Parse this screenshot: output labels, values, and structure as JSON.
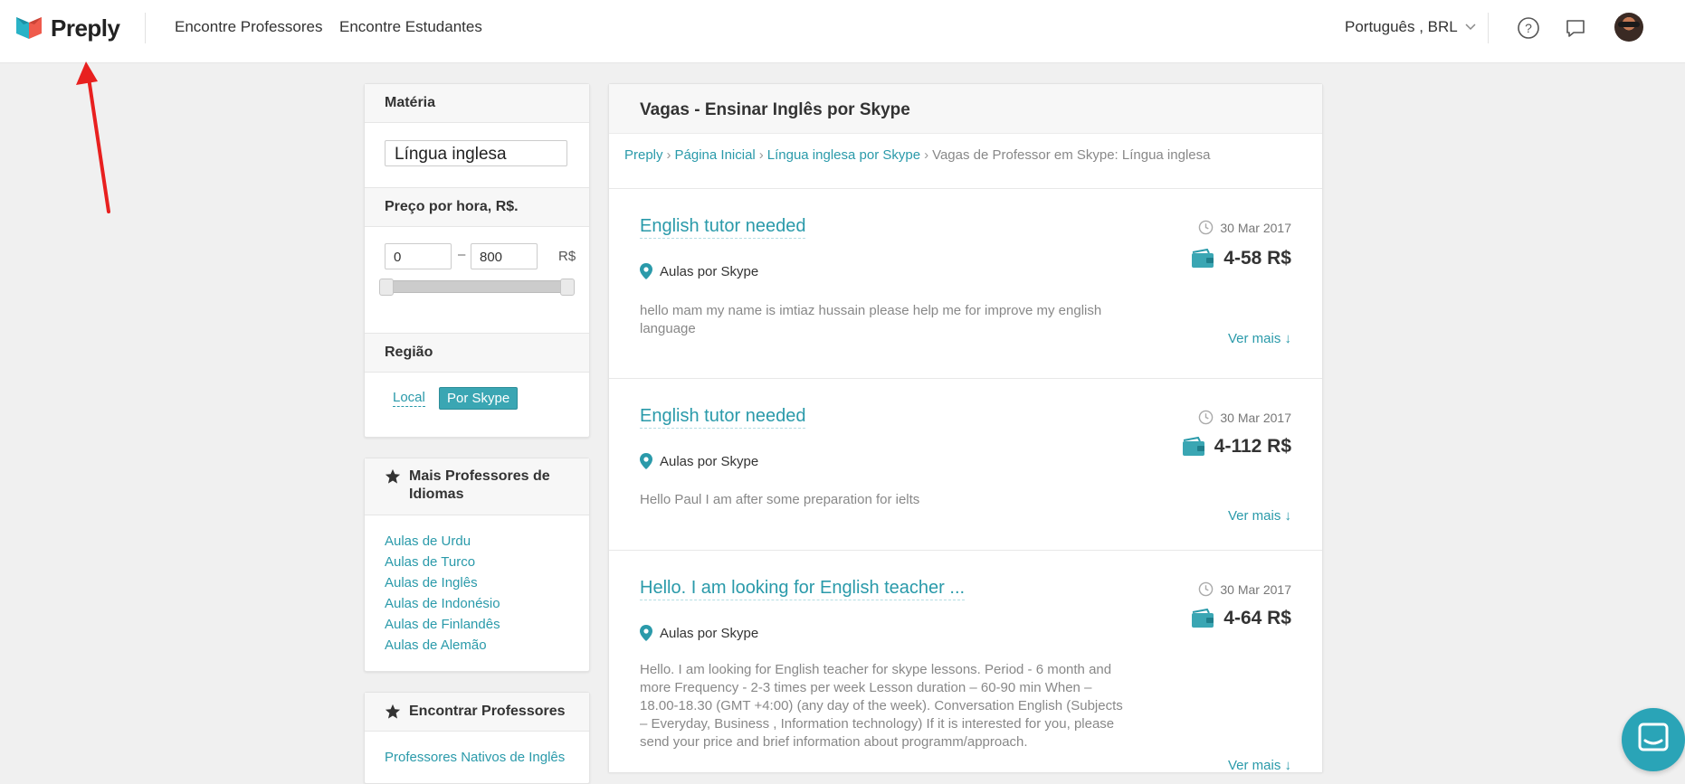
{
  "header": {
    "brand": "Preply",
    "nav": [
      "Encontre Professores",
      "Encontre Estudantes"
    ],
    "language": "Português , BRL"
  },
  "filters": {
    "subject_heading": "Matéria",
    "subject_value": "Língua inglesa",
    "price_heading": "Preço por hora, R$.",
    "price_min": "0",
    "price_max": "800",
    "price_dash": "–",
    "currency": "R$",
    "price_range_fraction": [
      0,
      1
    ],
    "region_heading": "Região",
    "region_options": [
      "Local",
      "Por Skype"
    ],
    "region_selected": "Por Skype"
  },
  "more_teachers": {
    "heading": "Mais Professores de Idiomas",
    "links": [
      "Aulas de Urdu",
      "Aulas de Turco",
      "Aulas de Inglês",
      "Aulas de Indonésio",
      "Aulas de Finlandês",
      "Aulas de Alemão"
    ]
  },
  "find_teachers": {
    "heading": "Encontrar Professores",
    "links": [
      "Professores Nativos de Inglês"
    ]
  },
  "main": {
    "title": "Vagas - Ensinar Inglês por Skype",
    "breadcrumb": [
      "Preply",
      "Página Inicial",
      "Língua inglesa por Skype",
      "Vagas de Professor em Skype: Língua inglesa"
    ],
    "breadcrumb_sep": "›",
    "jobs": [
      {
        "title": "English tutor needed",
        "location": "Aulas por Skype",
        "description": "hello mam my name is imtiaz hussain please help me for improve my english language",
        "date": "30 Mar 2017",
        "price": "4-58 R$",
        "more": "Ver mais ↓"
      },
      {
        "title": "English tutor needed",
        "location": "Aulas por Skype",
        "description": "Hello Paul I am after some preparation for ielts",
        "date": "30 Mar 2017",
        "price": "4-112 R$",
        "more": "Ver mais ↓"
      },
      {
        "title": "Hello. I am looking for English teacher ...",
        "location": "Aulas por Skype",
        "description": "Hello. I am looking for English teacher for skype lessons. Period - 6 month and more Frequency - 2-3 times per week Lesson duration – 60-90 min When – 18.00-18.30 (GMT +4:00) (any day of the week). Conversation English (Subjects – Everyday, Business , Information technology) If it is interested for you, please send your price and brief information about programm/approach.",
        "date": "30 Mar 2017",
        "price": "4-64 R$",
        "more": "Ver mais ↓"
      }
    ]
  },
  "colors": {
    "accent": "#2a9aaa",
    "selected_chip": "#3aa6b3",
    "annotation": "#e8201f"
  },
  "icons": [
    "help-icon",
    "messages-icon",
    "clock-icon",
    "wallet-icon",
    "location-pin-icon",
    "star-icon",
    "chat-icon"
  ]
}
